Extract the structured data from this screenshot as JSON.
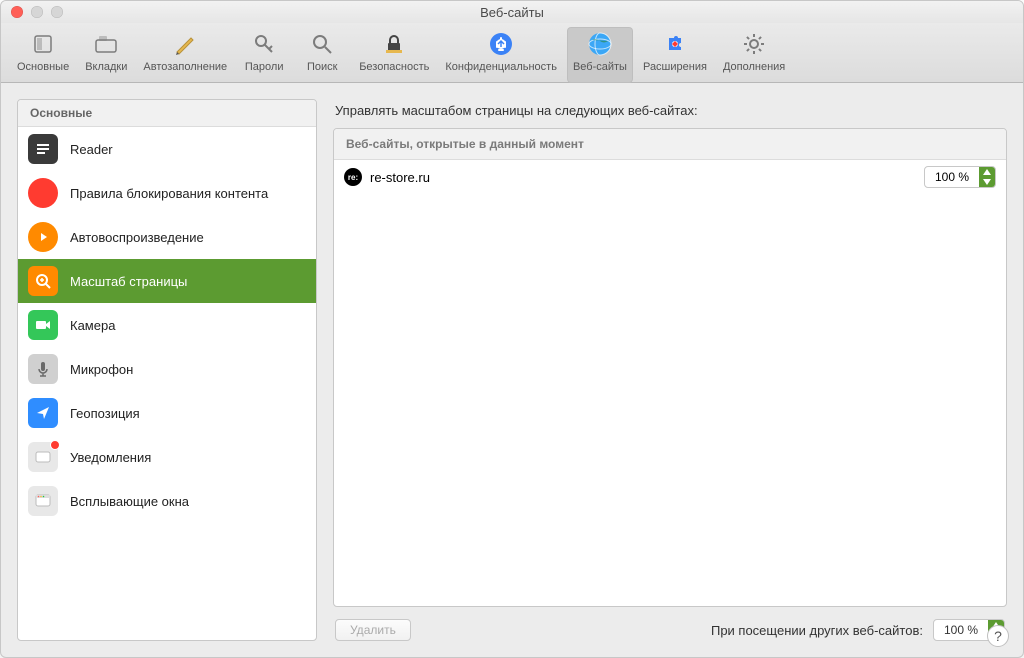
{
  "window": {
    "title": "Веб-сайты"
  },
  "toolbar": {
    "items": [
      {
        "label": "Основные",
        "icon": "switch"
      },
      {
        "label": "Вкладки",
        "icon": "tabs"
      },
      {
        "label": "Автозаполнение",
        "icon": "pen"
      },
      {
        "label": "Пароли",
        "icon": "key"
      },
      {
        "label": "Поиск",
        "icon": "search"
      },
      {
        "label": "Безопасность",
        "icon": "lock"
      },
      {
        "label": "Конфиденциальность",
        "icon": "hand"
      },
      {
        "label": "Веб-сайты",
        "icon": "globe",
        "selected": true
      },
      {
        "label": "Расширения",
        "icon": "puzzle"
      },
      {
        "label": "Дополнения",
        "icon": "gear"
      }
    ]
  },
  "sidebar": {
    "header": "Основные",
    "items": [
      {
        "label": "Reader",
        "icon": "reader"
      },
      {
        "label": "Правила блокирования контента",
        "icon": "block"
      },
      {
        "label": "Автовоспроизведение",
        "icon": "play"
      },
      {
        "label": "Масштаб страницы",
        "icon": "zoom",
        "selected": true
      },
      {
        "label": "Камера",
        "icon": "camera"
      },
      {
        "label": "Микрофон",
        "icon": "mic"
      },
      {
        "label": "Геопозиция",
        "icon": "geo"
      },
      {
        "label": "Уведомления",
        "icon": "notif",
        "dot": true
      },
      {
        "label": "Всплывающие окна",
        "icon": "popup"
      }
    ]
  },
  "main": {
    "title": "Управлять масштабом страницы на следующих веб-сайтах:",
    "box_header": "Веб-сайты, открытые в данный момент",
    "sites": [
      {
        "host": "re-store.ru",
        "favicon": "re:",
        "zoom": "100 %"
      }
    ],
    "delete_label": "Удалить",
    "default_label": "При посещении других веб-сайтов:",
    "default_zoom": "100 %"
  }
}
